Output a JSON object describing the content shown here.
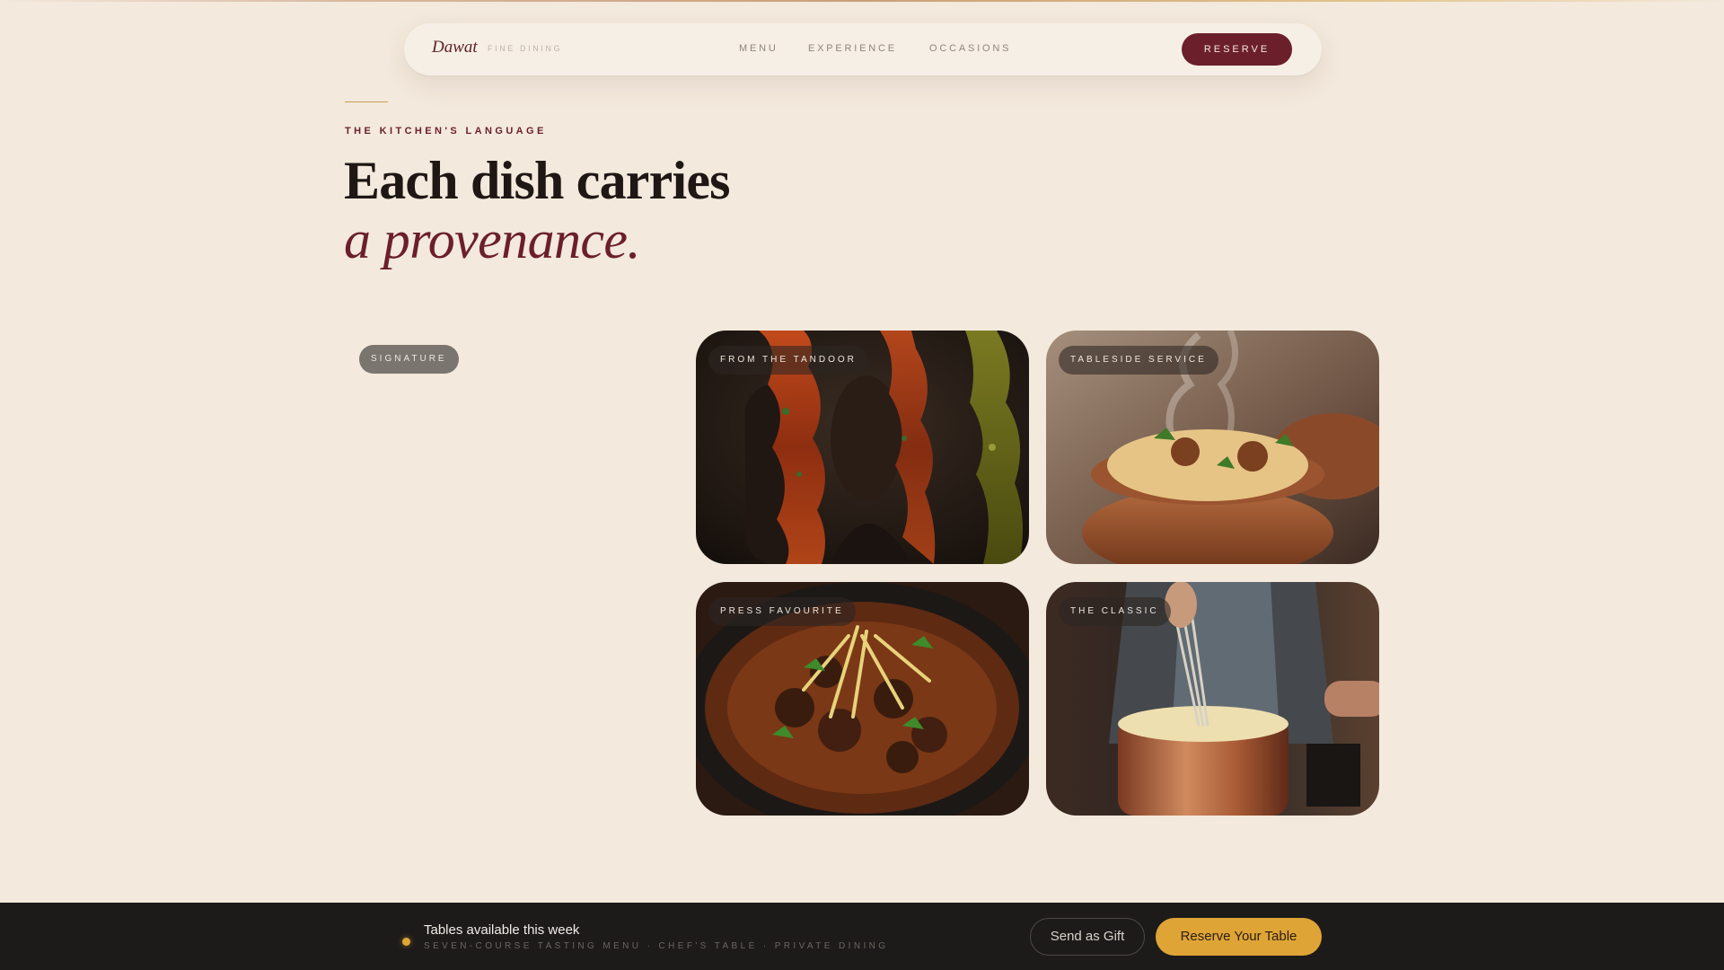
{
  "nav": {
    "brand": "Dawat",
    "brand_sub": "FINE DINING",
    "links": [
      "MENU",
      "EXPERIENCE",
      "OCCASIONS"
    ],
    "reserve": "RESERVE"
  },
  "hero": {
    "eyebrow": "THE KITCHEN'S LANGUAGE",
    "headline": "Each dish carries",
    "headline_em": "a provenance."
  },
  "gallery": {
    "signature_tag": "SIGNATURE",
    "cards": [
      {
        "tag": "FROM THE TANDOOR",
        "image": "tandoori skewers"
      },
      {
        "tag": "TABLESIDE SERVICE",
        "image": "biryani clay pot"
      },
      {
        "tag": "PRESS FAVOURITE",
        "image": "curry bowl"
      },
      {
        "tag": "THE CLASSIC",
        "image": "chef whisking copper pot"
      }
    ]
  },
  "bottom_bar": {
    "title": "Tables available this week",
    "subtitle": "SEVEN-COURSE TASTING MENU · CHEF'S TABLE · PRIVATE DINING",
    "gift_button": "Send as Gift",
    "reserve_button": "Reserve Your Table"
  },
  "colors": {
    "background": "#f3e9dc",
    "accent_wine": "#6b1f2b",
    "accent_gold": "#dea436",
    "bar": "#1d1b1a"
  }
}
